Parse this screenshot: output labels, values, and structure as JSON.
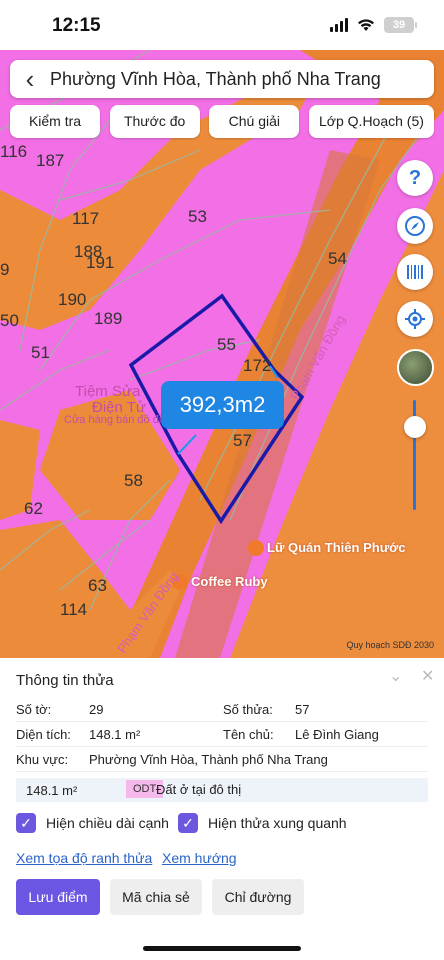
{
  "status": {
    "time": "12:15",
    "battery": "39"
  },
  "map": {
    "search_title": "Phường Vĩnh Hòa, Thành phố Nha Trang",
    "chips": [
      "Kiểm tra",
      "Thước đo",
      "Chú giải",
      "Lớp Q.Hoạch (5)"
    ],
    "parcel_labels": [
      "116",
      "187",
      "117",
      "53",
      "188",
      "191",
      "54",
      "9",
      "190",
      "189",
      "50",
      "55",
      "172",
      "51",
      "57",
      "58",
      "62",
      "63",
      "114"
    ],
    "poi": [
      "Tiệm Sửa",
      "Điện Tử",
      "Cửa hàng bán đồ điện",
      "Lữ Quán Thiên Phước",
      "Coffee Ruby"
    ],
    "street": "Phạm Văn Đồng",
    "area_badge": "392,3m2",
    "credit": "Quy hoạch SDĐ 2030",
    "fab_help": "?",
    "icons": [
      "back-arrow-icon",
      "help-icon",
      "compass-icon",
      "barcode-icon",
      "locate-icon"
    ],
    "colors": {
      "residential": "#f26fe6",
      "road": "#ec8c3a",
      "parcel_outline": "#1a1aa8",
      "badge": "#1f86e3"
    }
  },
  "panel": {
    "title": "Thông tin thửa",
    "so_to_label": "Số tờ:",
    "so_to_value": "29",
    "so_thua_label": "Số thửa:",
    "so_thua_value": "57",
    "dien_tich_label": "Diện tích:",
    "dien_tich_value": "148.1 m²",
    "ten_chu_label": "Tên chủ:",
    "ten_chu_value": "Lê Đình Giang",
    "khu_vuc_label": "Khu vực:",
    "khu_vuc_value": "Phường Vĩnh Hòa, Thành phố Nha Trang",
    "strip_area": "148.1 m²",
    "strip_code": "ODT",
    "strip_desc": "Đất ở tại đô thị",
    "check1": "Hiện chiều dài cạnh",
    "check2": "Hiện thửa xung quanh",
    "link1": "Xem tọa độ ranh thửa",
    "link2": "Xem hướng",
    "btn_save": "Lưu điểm",
    "btn_share": "Mã chia sẻ",
    "btn_route": "Chỉ đường"
  }
}
